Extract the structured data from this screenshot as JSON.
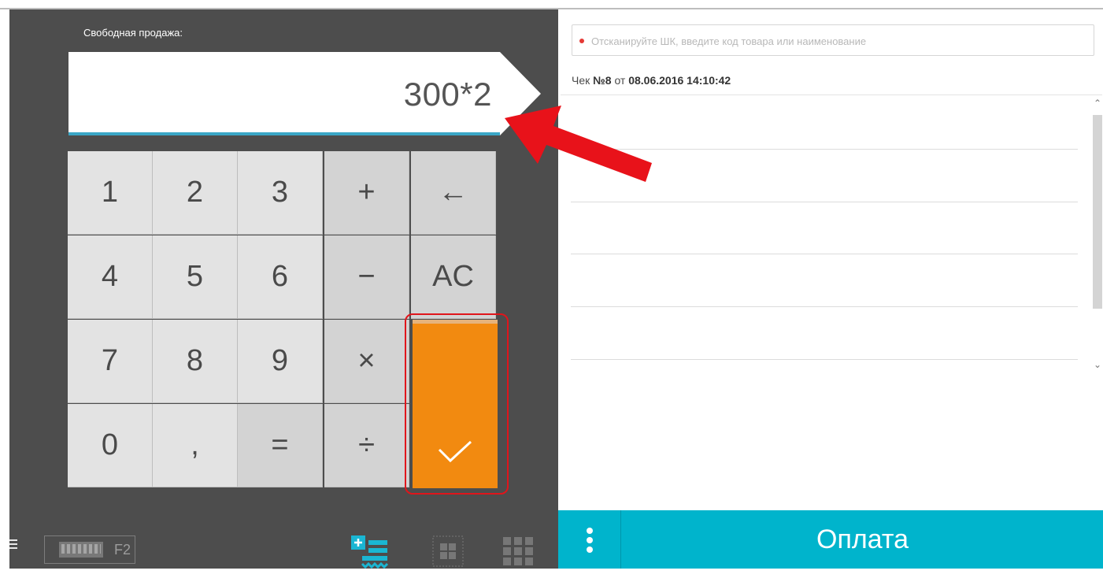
{
  "calculator": {
    "title": "Свободная продажа:",
    "display_value": "300*2",
    "keys": [
      "1",
      "2",
      "3",
      "+",
      "←",
      "4",
      "5",
      "6",
      "−",
      "AC",
      "7",
      "8",
      "9",
      "×",
      "0",
      ",",
      "=",
      "÷"
    ],
    "enter_symbol": "✓"
  },
  "toolbar": {
    "keyboard_shortcut": "F2"
  },
  "search": {
    "placeholder": "Отсканируйте ШК, введите код товара или наименование",
    "value": ""
  },
  "receipt": {
    "label": "Чек",
    "number": "№8",
    "from": "от",
    "datetime": "08.06.2016 14:10:42"
  },
  "footer": {
    "pay_label": "Оплата"
  },
  "colors": {
    "panel_bg": "#4d4d4d",
    "accent_orange": "#f28a10",
    "accent_cyan": "#00b4cc",
    "display_underline": "#3aa6c6",
    "highlight_red": "#e0151b"
  },
  "icons": [
    "menu-icon",
    "keyboard-icon",
    "free-sale-icon",
    "grid-small-icon",
    "grid-large-icon",
    "more-icon"
  ]
}
